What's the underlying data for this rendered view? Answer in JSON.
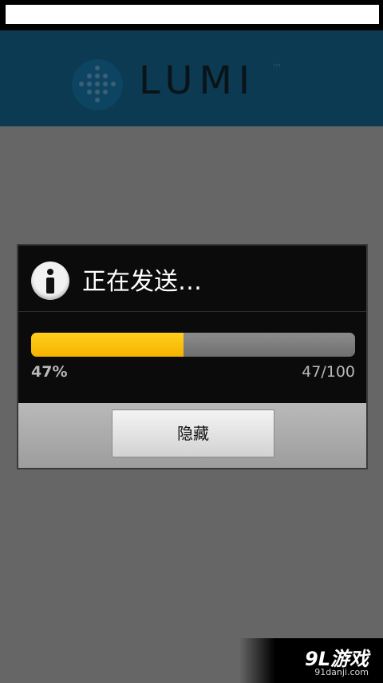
{
  "app": {
    "logo_text": "LUMI",
    "logo_sup": "™"
  },
  "dialog": {
    "icon": "info-icon",
    "title": "正在发送…",
    "progress": {
      "fraction": 0.47,
      "percent_label": "47%",
      "count_label": "47/100"
    },
    "hide_button": "隐藏"
  },
  "watermark": {
    "main": "9L游戏",
    "sub": "91danji.com"
  },
  "colors": {
    "appbar": "#0b3a52",
    "progress_fill": "#f4b400",
    "overlay": "#666666"
  }
}
